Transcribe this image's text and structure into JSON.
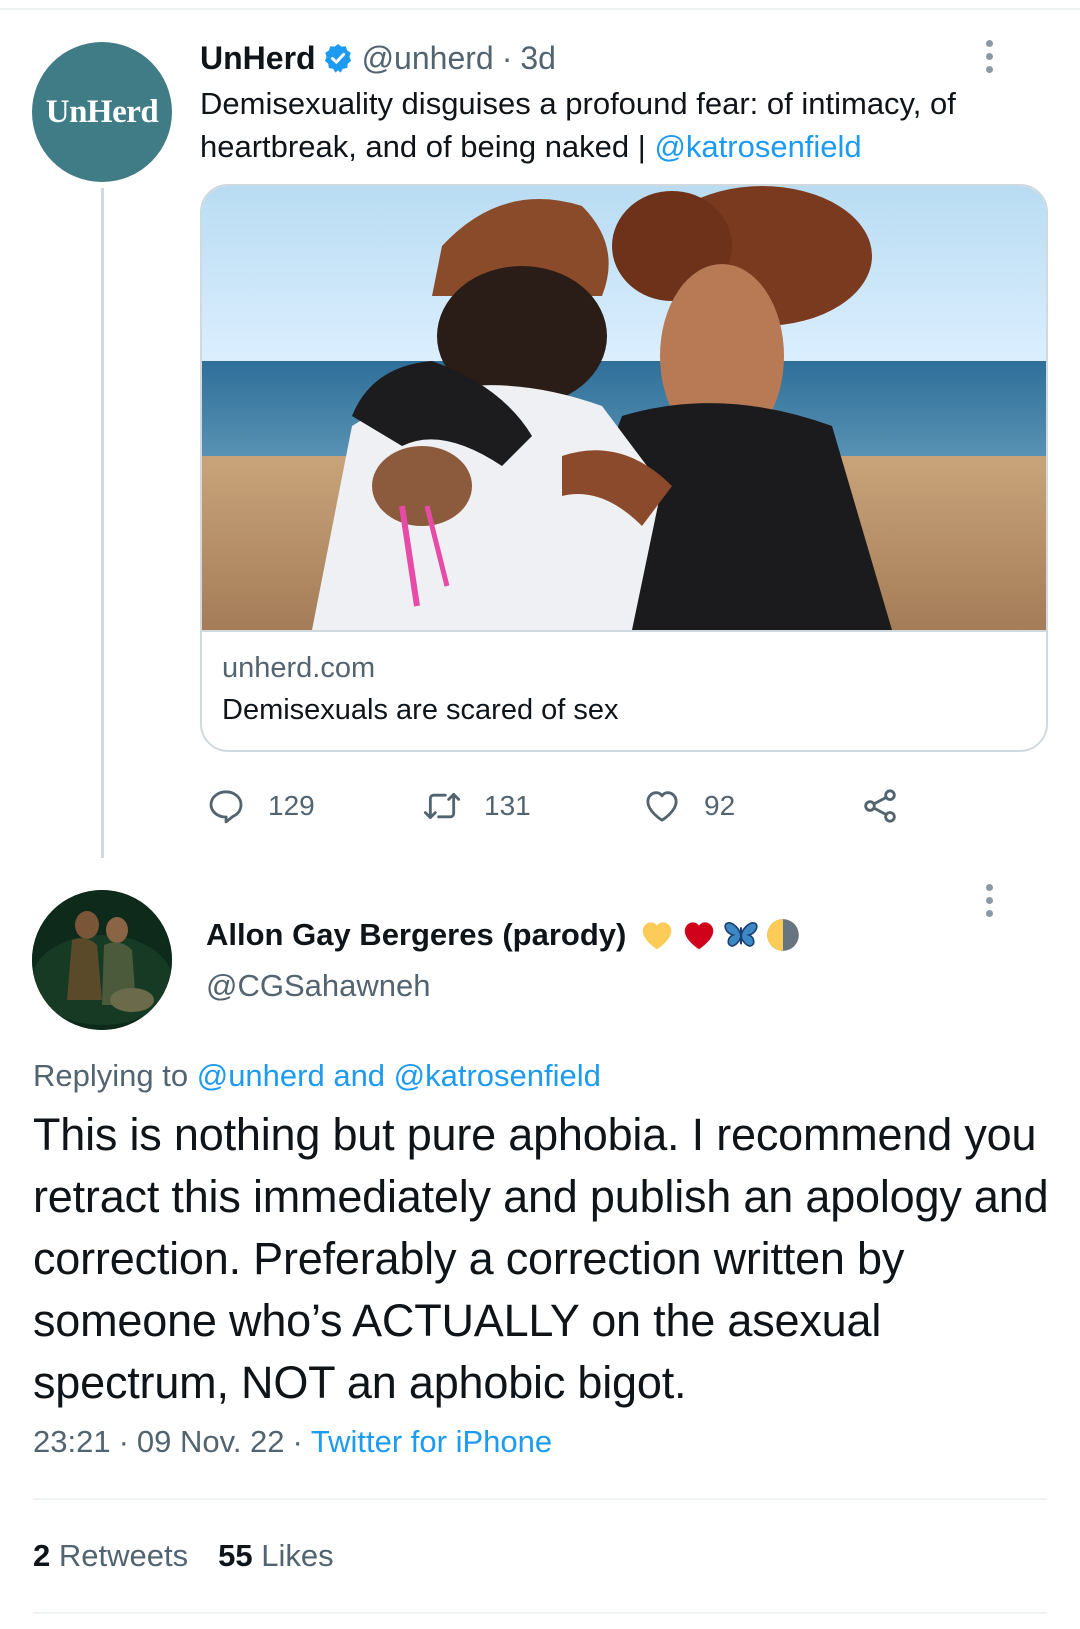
{
  "tweet1": {
    "avatar_text": "UnHerd",
    "name": "UnHerd",
    "handle": "@unherd",
    "separator": "·",
    "time": "3d",
    "text_plain": "Demisexuality disguises a profound fear: of intimacy, of heartbreak, and of being naked | ",
    "text_mention": "@katrosenfield",
    "card": {
      "domain": "unherd.com",
      "title": "Demisexuals are scared of sex"
    },
    "actions": {
      "replies": "129",
      "retweets": "131",
      "likes": "92"
    }
  },
  "tweet2": {
    "name": "Allon Gay Bergeres (parody)",
    "emojis": [
      "yellow-heart",
      "red-heart",
      "butterfly",
      "first-quarter-moon"
    ],
    "handle": "@CGSahawneh",
    "replying_prefix": "Replying to ",
    "replying_to": "@unherd and @katrosenfield",
    "body": "This is nothing but pure aphobia. I recommend you retract this immediately and publish an apology and correction. Preferably a correction written by someone who’s ACTUALLY on the asexual spectrum, NOT an aphobic bigot.",
    "time": "23:21",
    "date": "09 Nov. 22",
    "separator": "·",
    "source": "Twitter for iPhone",
    "retweets_count": "2",
    "retweets_label": "Retweets",
    "likes_count": "55",
    "likes_label": "Likes"
  },
  "colors": {
    "link": "#1d9bf0",
    "secondary_text": "#536471",
    "unherd_teal": "#3f7c86",
    "verified": "#1d9bf0"
  }
}
